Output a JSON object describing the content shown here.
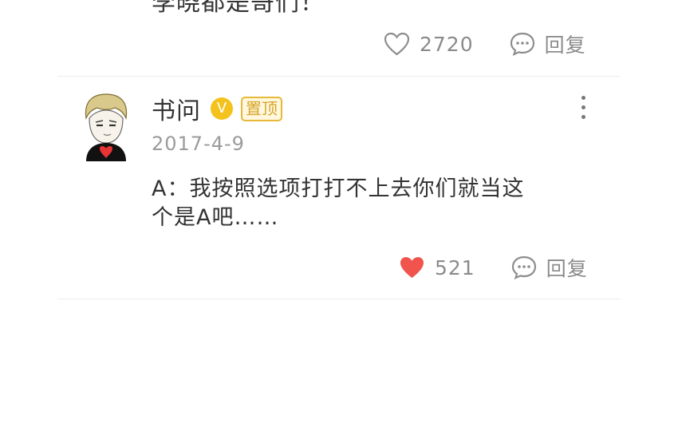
{
  "previous_comment": {
    "text_partial": "李晓都是哥们！",
    "like_count": "2720",
    "reply_label": "回复"
  },
  "comment": {
    "username": "书问",
    "verified_badge": "V",
    "pinned_badge": "置顶",
    "date": "2017-4-9",
    "text_line1": "A：我按照选项打打不上去你们就当这",
    "text_line2": "个是A吧……",
    "like_count": "521",
    "reply_label": "回复",
    "liked": true
  },
  "icons": {
    "heart_outline": "heart-outline-icon",
    "heart_filled": "heart-filled-icon",
    "reply": "comment-bubble-icon",
    "more": "more-vertical-icon"
  },
  "colors": {
    "liked_heart": "#f0544c",
    "verified": "#f4c21c",
    "pin_border": "#e6b93a",
    "muted_text": "#8b8b8b"
  }
}
